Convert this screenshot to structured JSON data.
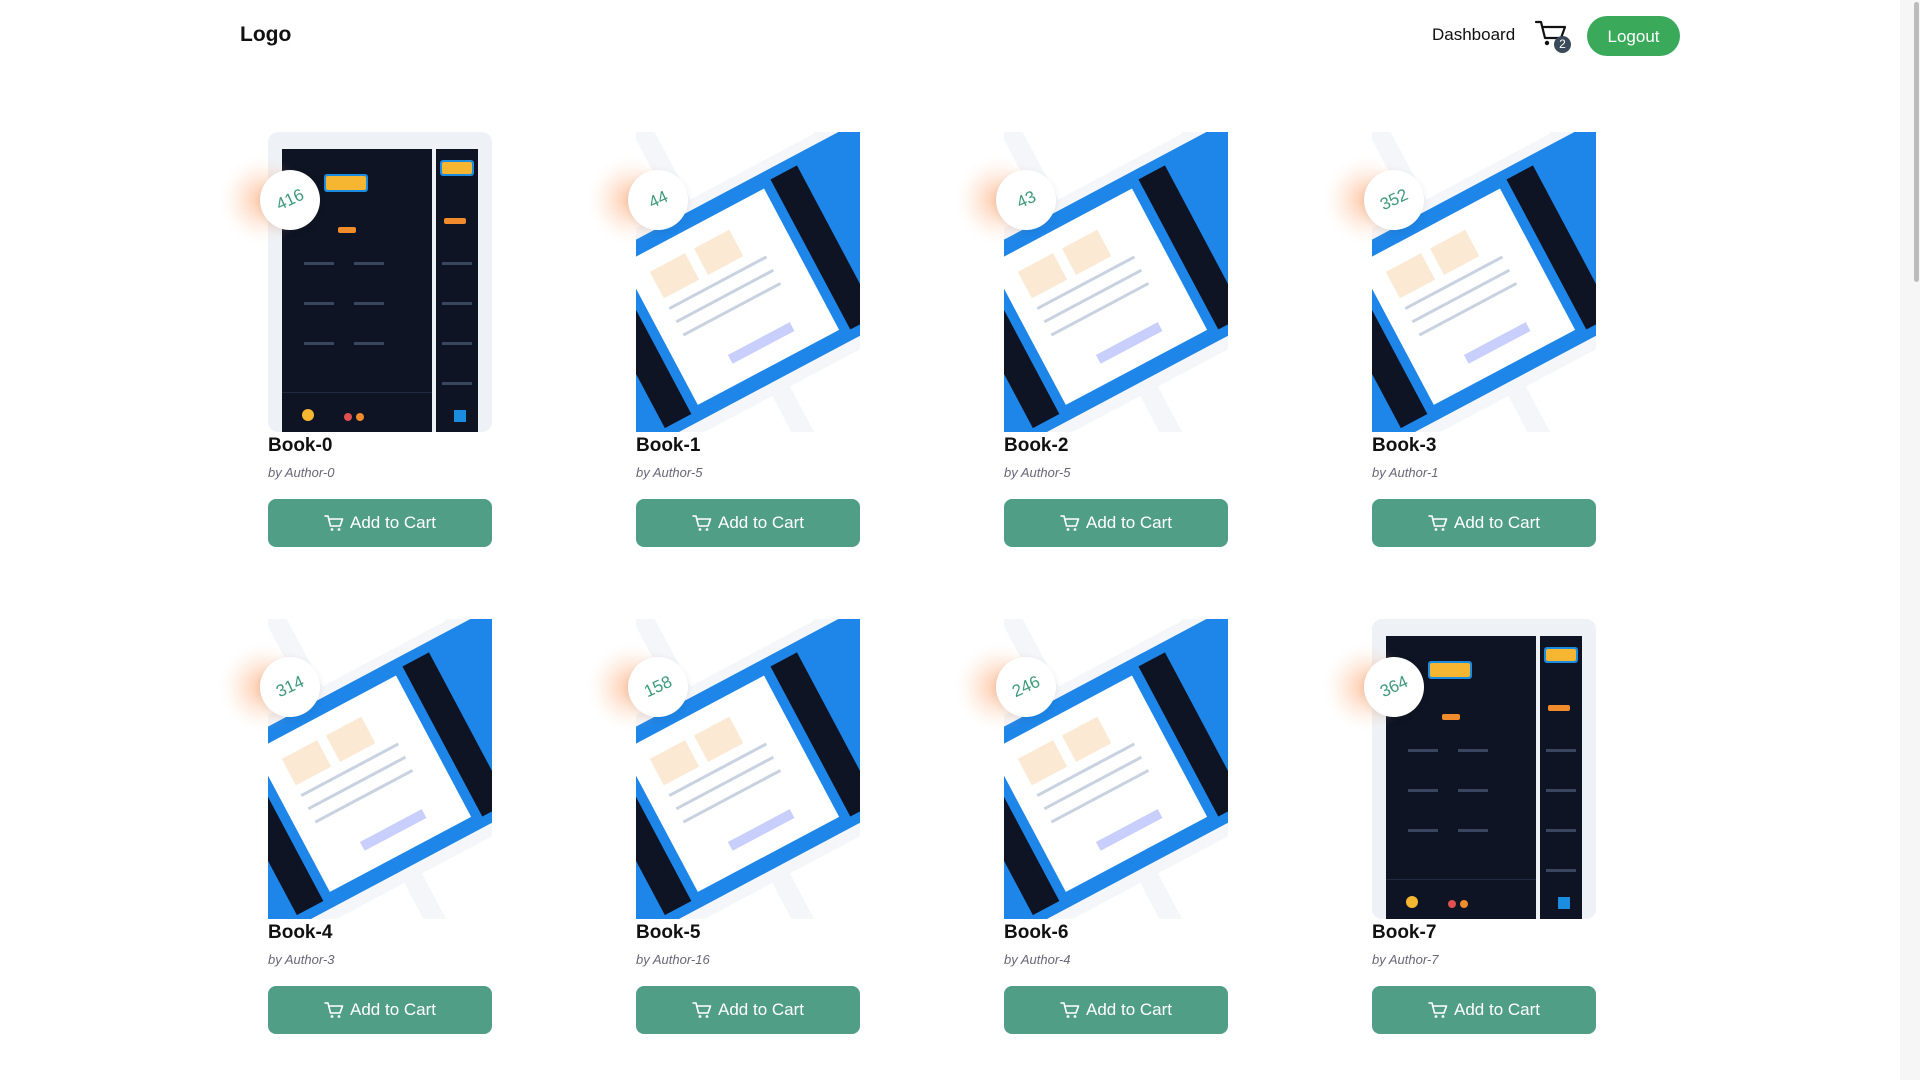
{
  "header": {
    "logo": "Logo",
    "dashboard_label": "Dashboard",
    "cart_count": "2",
    "logout_label": "Logout"
  },
  "cart_button_label": "Add to Cart",
  "author_prefix": "by",
  "books": [
    {
      "title": "Book-0",
      "author": "by Author-0",
      "price": "416",
      "cover": "dark"
    },
    {
      "title": "Book-1",
      "author": "by Author-5",
      "price": "44",
      "cover": "blue"
    },
    {
      "title": "Book-2",
      "author": "by Author-5",
      "price": "43",
      "cover": "blue"
    },
    {
      "title": "Book-3",
      "author": "by Author-1",
      "price": "352",
      "cover": "blue"
    },
    {
      "title": "Book-4",
      "author": "by Author-3",
      "price": "314",
      "cover": "blue"
    },
    {
      "title": "Book-5",
      "author": "by Author-16",
      "price": "158",
      "cover": "blue"
    },
    {
      "title": "Book-6",
      "author": "by Author-4",
      "price": "246",
      "cover": "blue"
    },
    {
      "title": "Book-7",
      "author": "by Author-7",
      "price": "364",
      "cover": "dark"
    }
  ],
  "colors": {
    "accent": "#519e87",
    "logout": "#3aaa5a",
    "price_text": "#3f9a7a"
  }
}
